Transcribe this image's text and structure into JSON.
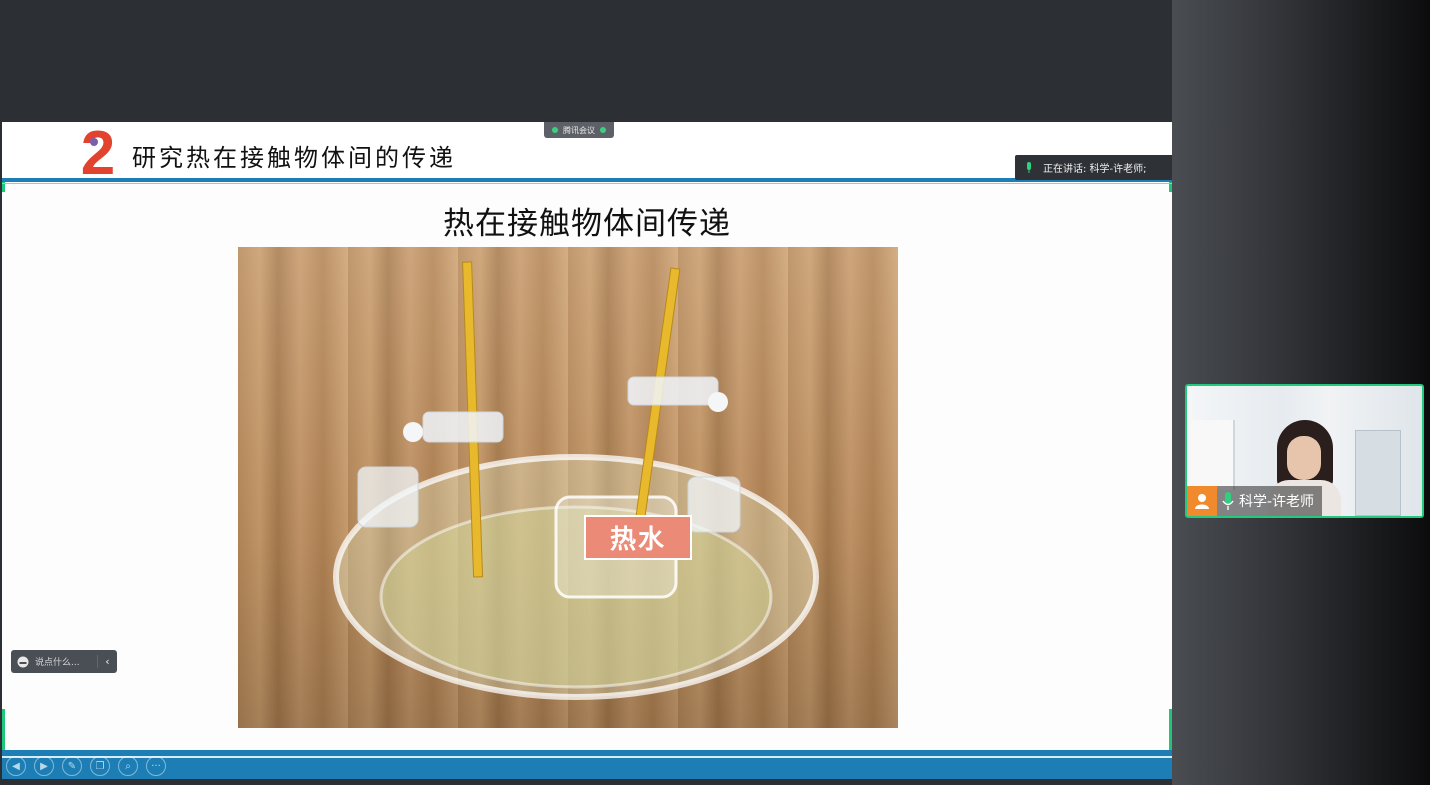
{
  "meeting": {
    "app_tag": "腾讯会议",
    "speaking_text": "正在讲话: 科学-许老师;"
  },
  "slide": {
    "section_number": "2",
    "section_title": "研究热在接触物体间的传递",
    "main_title": "热在接触物体间传递",
    "photo_label": "热水"
  },
  "chat": {
    "placeholder": "说点什么...",
    "collapse": "‹"
  },
  "toolbar": {
    "icons": [
      "prev-icon",
      "next-icon",
      "pen-icon",
      "copy-icon",
      "zoom-icon",
      "more-icon"
    ],
    "more_label": "···"
  },
  "video": {
    "participant_name": "科学-许老师"
  },
  "colors": {
    "accent_green": "#23c97d",
    "header_blue": "#1d7eb5",
    "label_salmon": "#ea8a77",
    "badge_red": "#e2432f"
  }
}
